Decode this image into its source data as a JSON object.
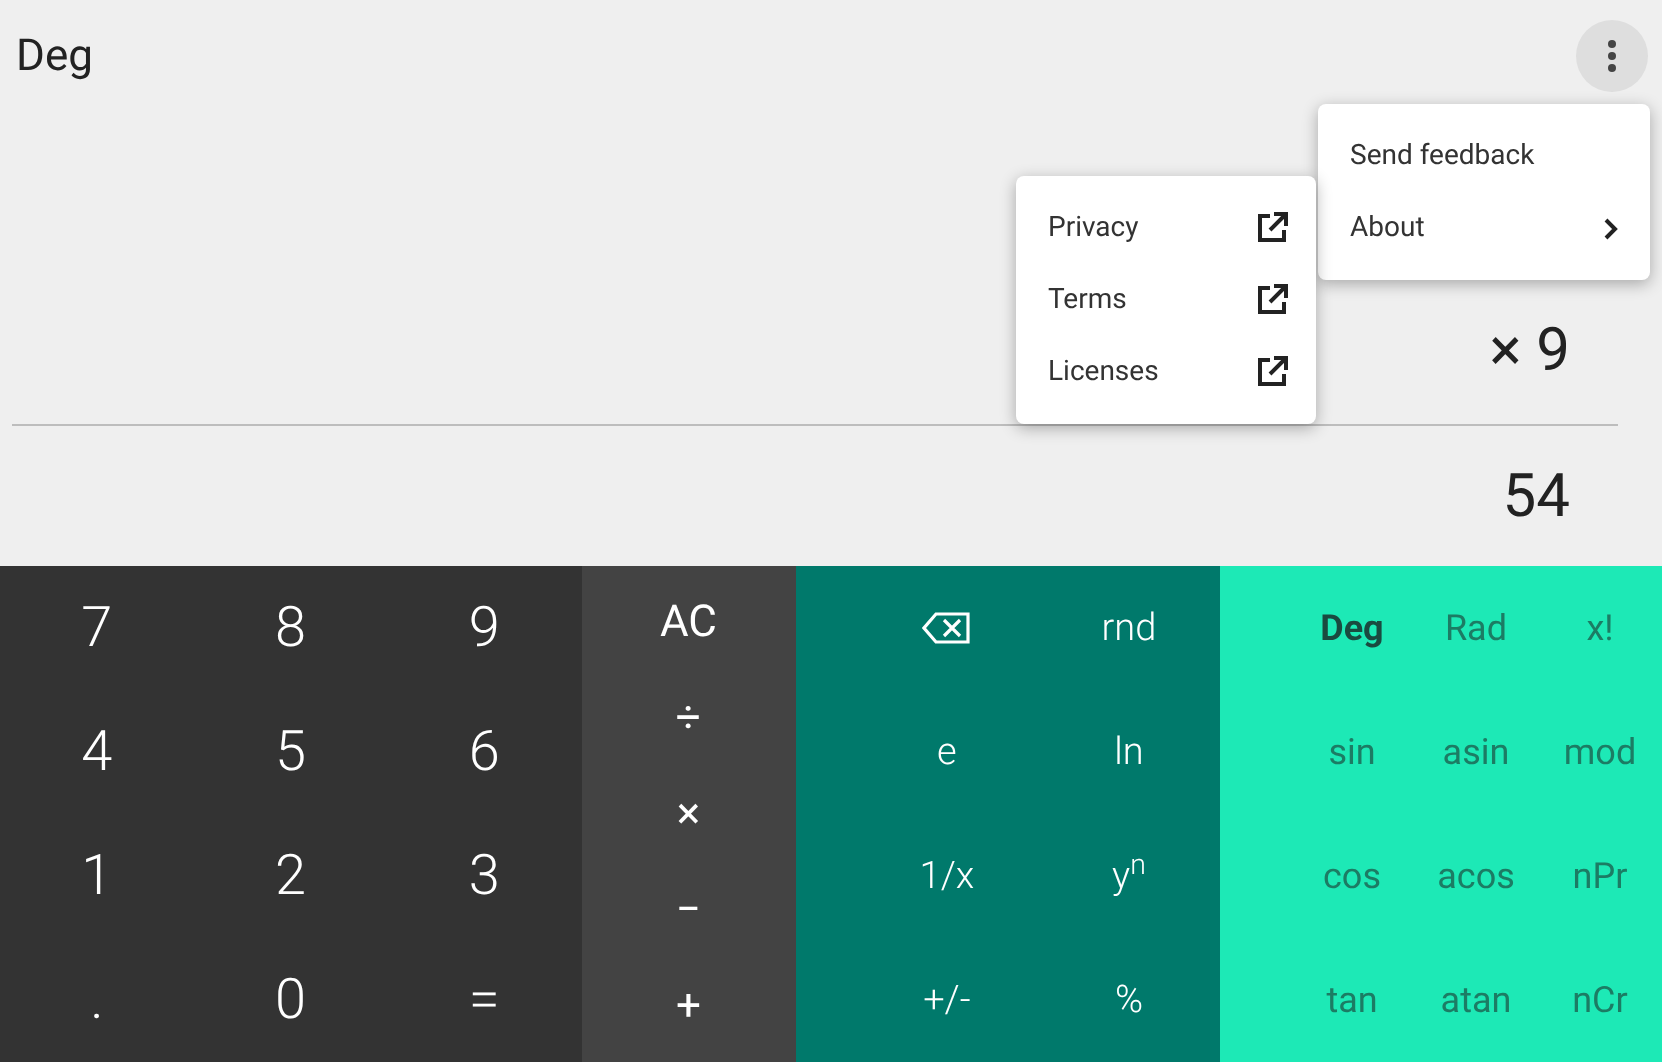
{
  "header": {
    "mode": "Deg"
  },
  "expression": [
    "× 9"
  ],
  "result": "54",
  "menu": [
    {
      "label": "Send feedback",
      "kind": "plain"
    },
    {
      "label": "About",
      "kind": "submenu"
    }
  ],
  "submenu": [
    {
      "label": "Privacy"
    },
    {
      "label": "Terms"
    },
    {
      "label": "Licenses"
    }
  ],
  "keypad": {
    "numbers": [
      [
        "7",
        "8",
        "9"
      ],
      [
        "4",
        "5",
        "6"
      ],
      [
        "1",
        "2",
        "3"
      ],
      [
        ".",
        "0",
        "="
      ]
    ],
    "operators": [
      {
        "label": "AC",
        "kind": "text"
      },
      {
        "label": "÷",
        "kind": "text"
      },
      {
        "label": "×",
        "kind": "text"
      },
      {
        "label": "−",
        "kind": "text"
      },
      {
        "label": "+",
        "kind": "text"
      }
    ],
    "functions": [
      [
        {
          "kind": "backspace"
        },
        {
          "label": "rnd",
          "kind": "text"
        }
      ],
      [
        {
          "label": "e",
          "kind": "text"
        },
        {
          "label": "ln",
          "kind": "text"
        }
      ],
      [
        {
          "label": "1/x",
          "kind": "text"
        },
        {
          "label": "y$^{n}$",
          "kind": "text"
        }
      ],
      [
        {
          "label": "+/-",
          "kind": "text"
        },
        {
          "label": "%",
          "kind": "text"
        }
      ]
    ],
    "advanced": [
      [
        {
          "label": "Deg",
          "selected": true
        },
        {
          "label": "Rad",
          "selected": false
        },
        {
          "label": "x!"
        }
      ],
      [
        {
          "label": "sin"
        },
        {
          "label": "asin"
        },
        {
          "label": "mod"
        }
      ],
      [
        {
          "label": "cos"
        },
        {
          "label": "acos"
        },
        {
          "label": "nPr"
        }
      ],
      [
        {
          "label": "tan"
        },
        {
          "label": "atan"
        },
        {
          "label": "nCr"
        }
      ]
    ]
  }
}
